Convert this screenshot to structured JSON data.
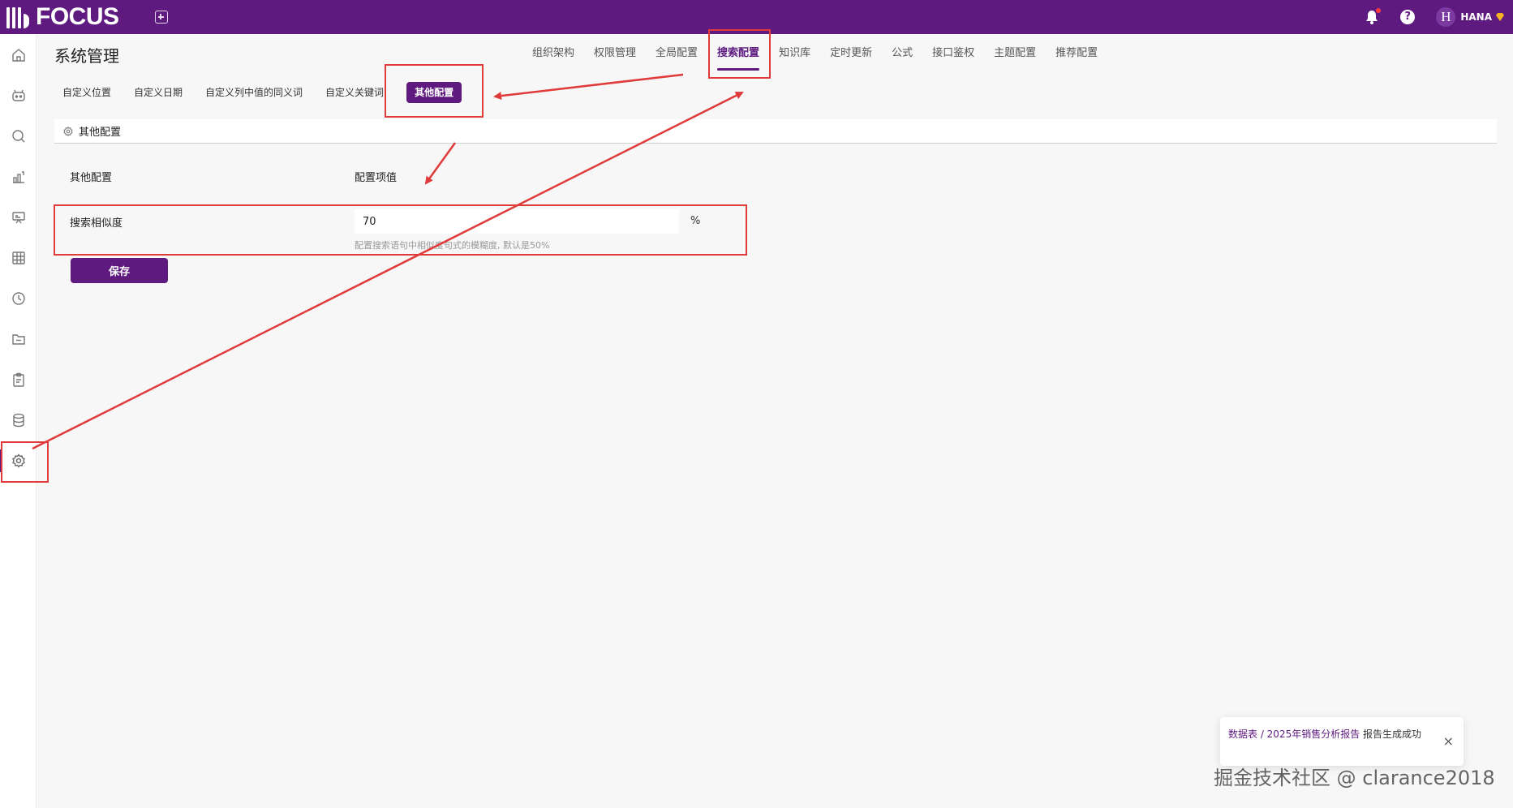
{
  "app": {
    "logo_text": "FOCUS",
    "user_initial": "H",
    "username": "HANA",
    "help_label": "?"
  },
  "page": {
    "title": "系统管理"
  },
  "main_tabs": [
    {
      "label": "组织架构",
      "active": false
    },
    {
      "label": "权限管理",
      "active": false
    },
    {
      "label": "全局配置",
      "active": false
    },
    {
      "label": "搜索配置",
      "active": true
    },
    {
      "label": "知识库",
      "active": false
    },
    {
      "label": "定时更新",
      "active": false
    },
    {
      "label": "公式",
      "active": false
    },
    {
      "label": "接口鉴权",
      "active": false
    },
    {
      "label": "主题配置",
      "active": false
    },
    {
      "label": "推荐配置",
      "active": false
    }
  ],
  "sub_tabs": [
    {
      "label": "自定义位置",
      "active": false
    },
    {
      "label": "自定义日期",
      "active": false
    },
    {
      "label": "自定义列中值的同义词",
      "active": false
    },
    {
      "label": "自定义关键词",
      "active": false
    },
    {
      "label": "其他配置",
      "active": true
    }
  ],
  "section": {
    "title": "其他配置",
    "col_name": "其他配置",
    "col_value": "配置项值"
  },
  "setting": {
    "label": "搜索相似度",
    "value": "70",
    "unit": "%",
    "hint": "配置搜索语句中相似度句式的模糊度, 默认是50%"
  },
  "save_label": "保存",
  "toast": {
    "link_text": "数据表 / 2025年销售分析报告",
    "message": "报告生成成功",
    "close": "×"
  },
  "watermark": "掘金技术社区 @ clarance2018",
  "colors": {
    "brand": "#5e1a7f",
    "annotation": "#e03a3a"
  },
  "sidebar_icons": [
    "home-icon",
    "robot-icon",
    "search-icon",
    "chart-icon",
    "presentation-icon",
    "table-icon",
    "clock-icon",
    "folder-icon",
    "clipboard-icon",
    "database-icon",
    "settings-icon"
  ]
}
